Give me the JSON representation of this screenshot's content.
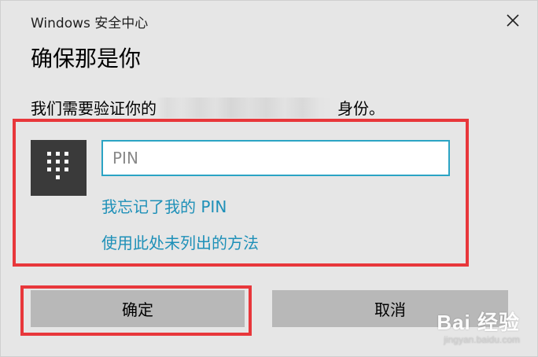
{
  "window": {
    "title": "Windows 安全中心",
    "close_icon": "close-icon"
  },
  "heading": "确保那是你",
  "message": {
    "before": "我们需要验证你的",
    "after": "身份。"
  },
  "pin": {
    "keypad_icon": "keypad-icon",
    "placeholder": "PIN",
    "value": "",
    "forgot_link": "我忘记了我的 PIN",
    "other_method_link": "使用此处未列出的方法"
  },
  "buttons": {
    "ok": "确定",
    "cancel": "取消"
  },
  "watermark": {
    "brand": "Bai 经验",
    "site": "jingyan.baidu.com"
  },
  "colors": {
    "accent": "#2ba4c4",
    "link": "#1e90b8",
    "annotation": "#e8373b",
    "background": "#e6e6e6",
    "button": "#b8b8b8"
  }
}
